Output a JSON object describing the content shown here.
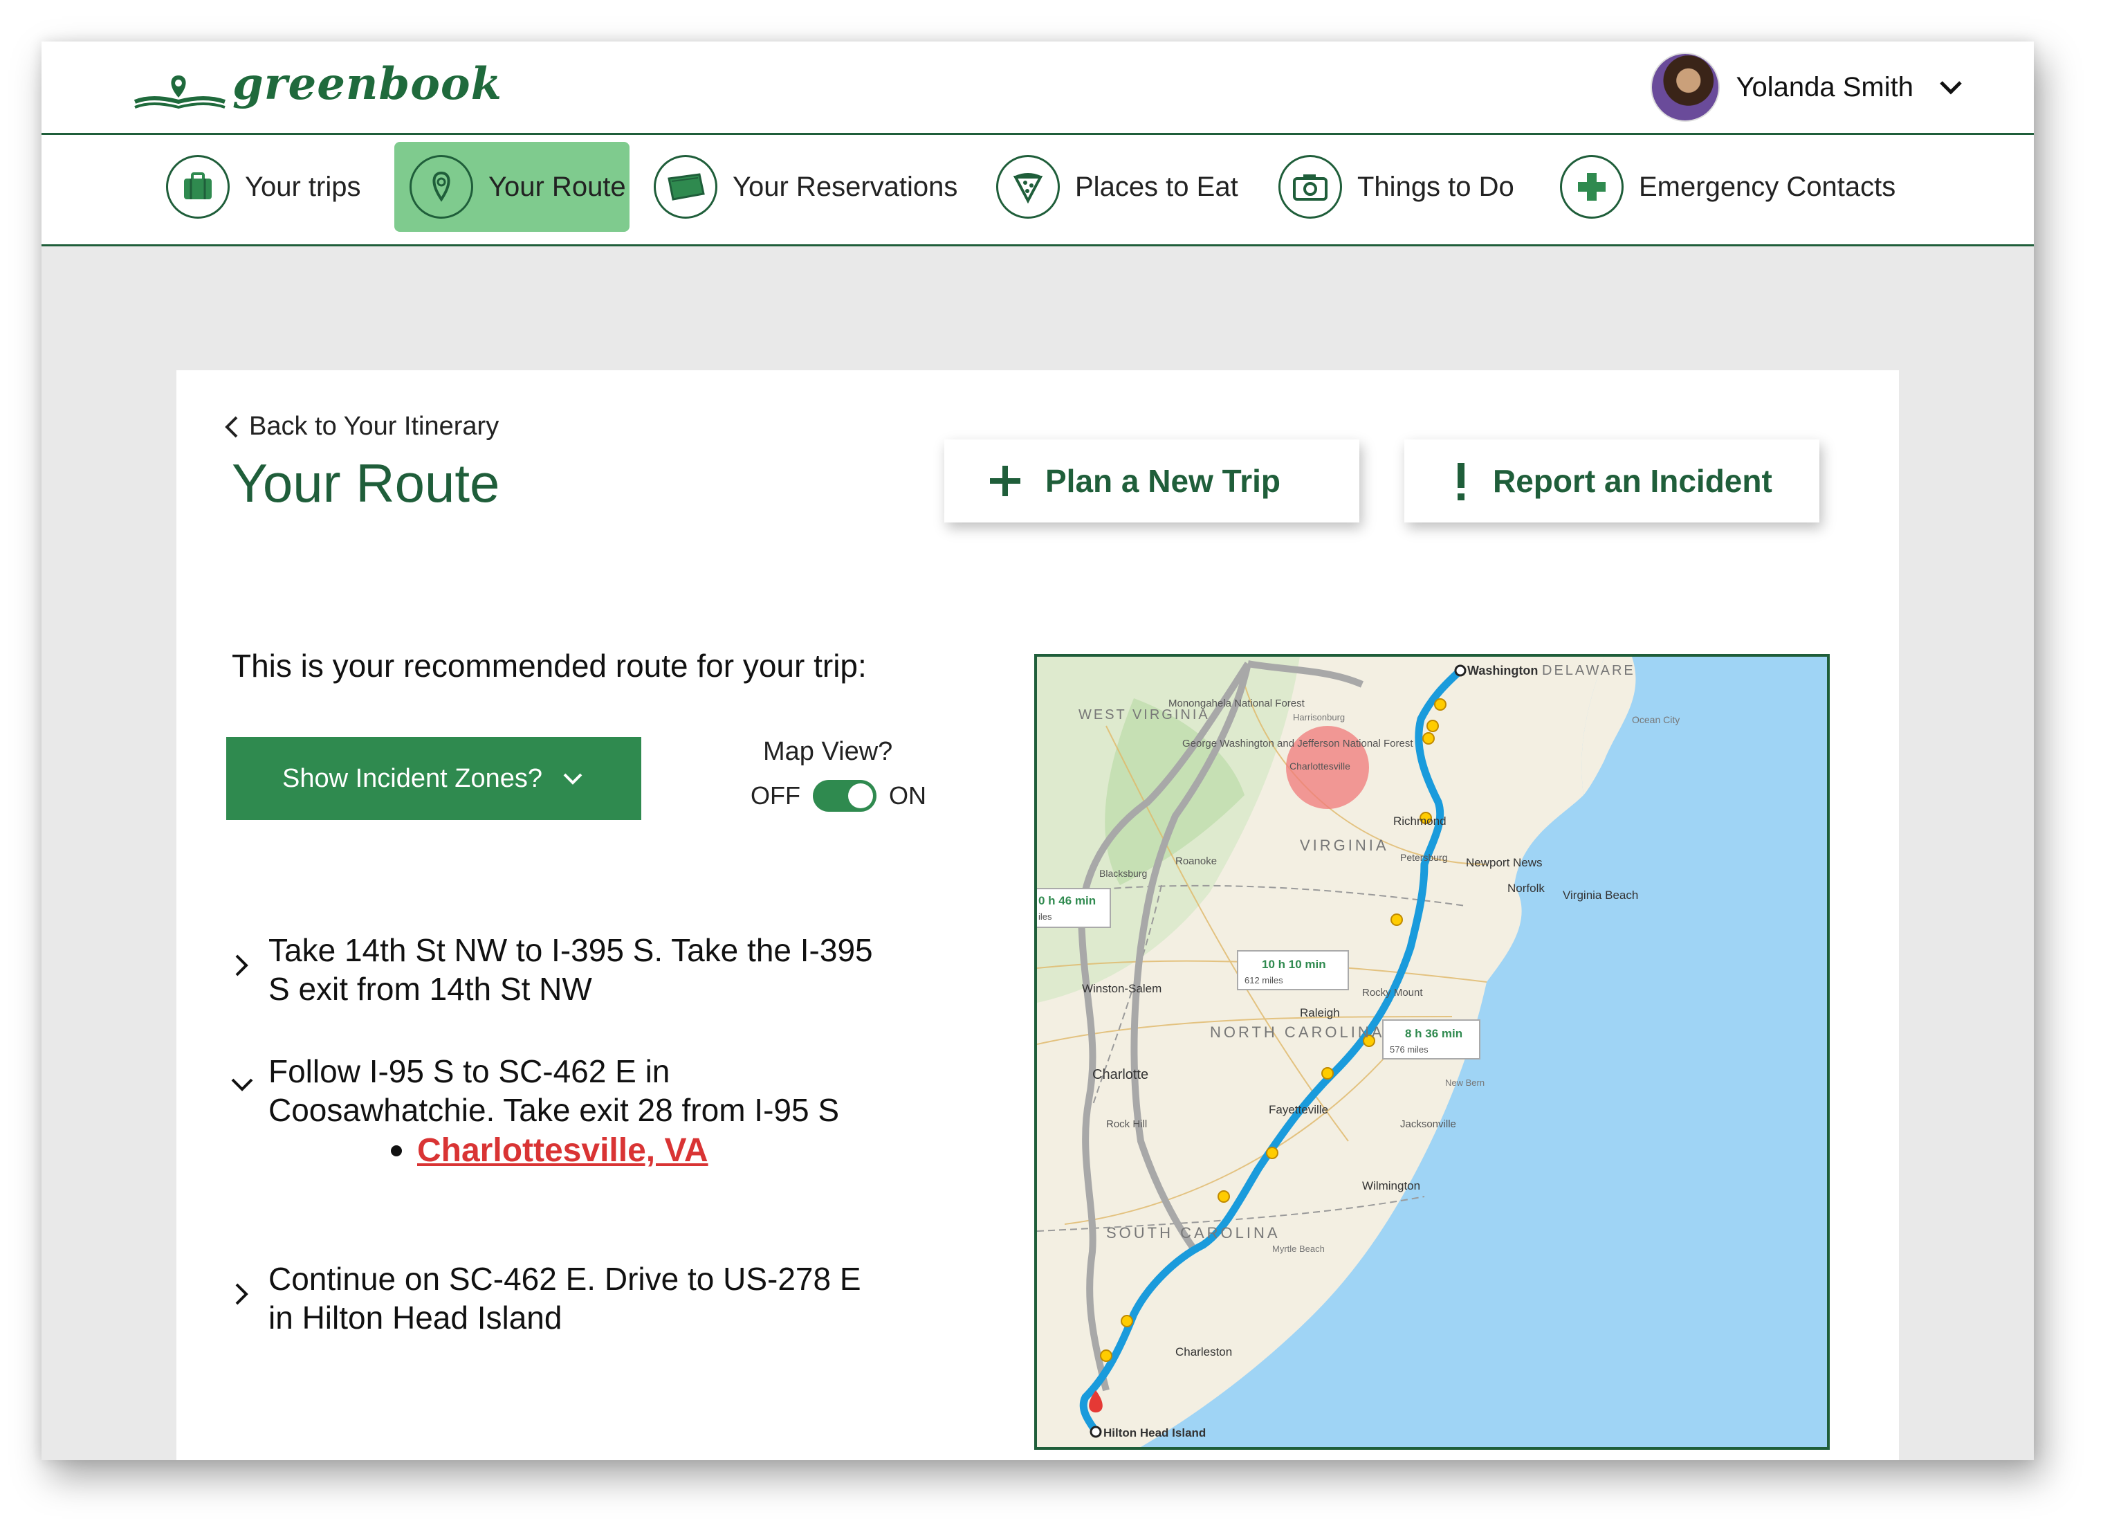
{
  "app": {
    "logo_text": "greenbook"
  },
  "user": {
    "name": "Yolanda Smith"
  },
  "nav": {
    "items": [
      {
        "label": "Your trips",
        "icon": "suitcase-icon"
      },
      {
        "label": "Your Route",
        "icon": "map-pin-icon",
        "active": true
      },
      {
        "label": "Your Reservations",
        "icon": "ticket-icon"
      },
      {
        "label": "Places to Eat",
        "icon": "pizza-icon"
      },
      {
        "label": "Things to Do",
        "icon": "camera-icon"
      },
      {
        "label": "Emergency Contacts",
        "icon": "medical-cross-icon"
      }
    ]
  },
  "page": {
    "back_label": "Back to Your Itinerary",
    "title": "Your Route",
    "plan_trip_label": "Plan a New Trip",
    "report_incident_label": "Report an Incident",
    "subtitle": "This is your recommended route for your trip:",
    "incident_zones_label": "Show Incident Zones?",
    "map_view_label": "Map View?",
    "toggle_off": "OFF",
    "toggle_on": "ON",
    "map_view_on": true
  },
  "steps": [
    {
      "text": "Take 14th St NW to I-395 S. Take the I-395 S exit from 14th St NW",
      "expanded": false
    },
    {
      "text": "Follow I-95 S to SC-462 E in Coosawhatchie. Take exit 28 from I-95 S",
      "expanded": true
    },
    {
      "text": "Continue on SC-462 E. Drive to US-278 E in Hilton Head Island",
      "expanded": false
    }
  ],
  "incident_location": "Charlottesville, VA",
  "map": {
    "labels": {
      "washington": "Washington",
      "delaware": "DELAWARE",
      "west_virginia": "WEST VIRGINIA",
      "virginia": "VIRGINIA",
      "north_carolina": "NORTH CAROLINA",
      "south_carolina": "SOUTH CAROLINA",
      "charlottesville": "Charlottesville",
      "richmond": "Richmond",
      "petersburg": "Petersburg",
      "newport_news": "Newport News",
      "norfolk": "Norfolk",
      "virginia_beach": "Virginia Beach",
      "roanoke": "Roanoke",
      "blacksburg": "Blacksburg",
      "winston_salem": "Winston-Salem",
      "raleigh": "Raleigh",
      "rocky_mount": "Rocky Mount",
      "charlotte": "Charlotte",
      "fayetteville": "Fayetteville",
      "rock_hill": "Rock Hill",
      "jacksonville": "Jacksonville",
      "wilmington": "Wilmington",
      "charleston": "Charleston",
      "hilton_head": "Hilton Head Island",
      "myrtle_beach": "Myrtle Beach",
      "forest": "Monongahela National Forest",
      "gw_forest": "George Washington and Jefferson National Forest",
      "harrisonburg": "Harrisonburg",
      "ocean_city": "Ocean City",
      "new_bern": "New Bern"
    },
    "route_boxes": [
      {
        "time": "10 h 10 min",
        "miles": "612 miles"
      },
      {
        "time": "8 h 36 min",
        "miles": "576 miles"
      },
      {
        "time": "0 h 46 min",
        "miles": "iles"
      }
    ],
    "colors": {
      "primary_route": "#1a9bdc",
      "alt_route": "#a8a8a8",
      "incident_zone": "#f07a7a",
      "water": "#9fd4f5",
      "land": "#f3efe2"
    }
  }
}
